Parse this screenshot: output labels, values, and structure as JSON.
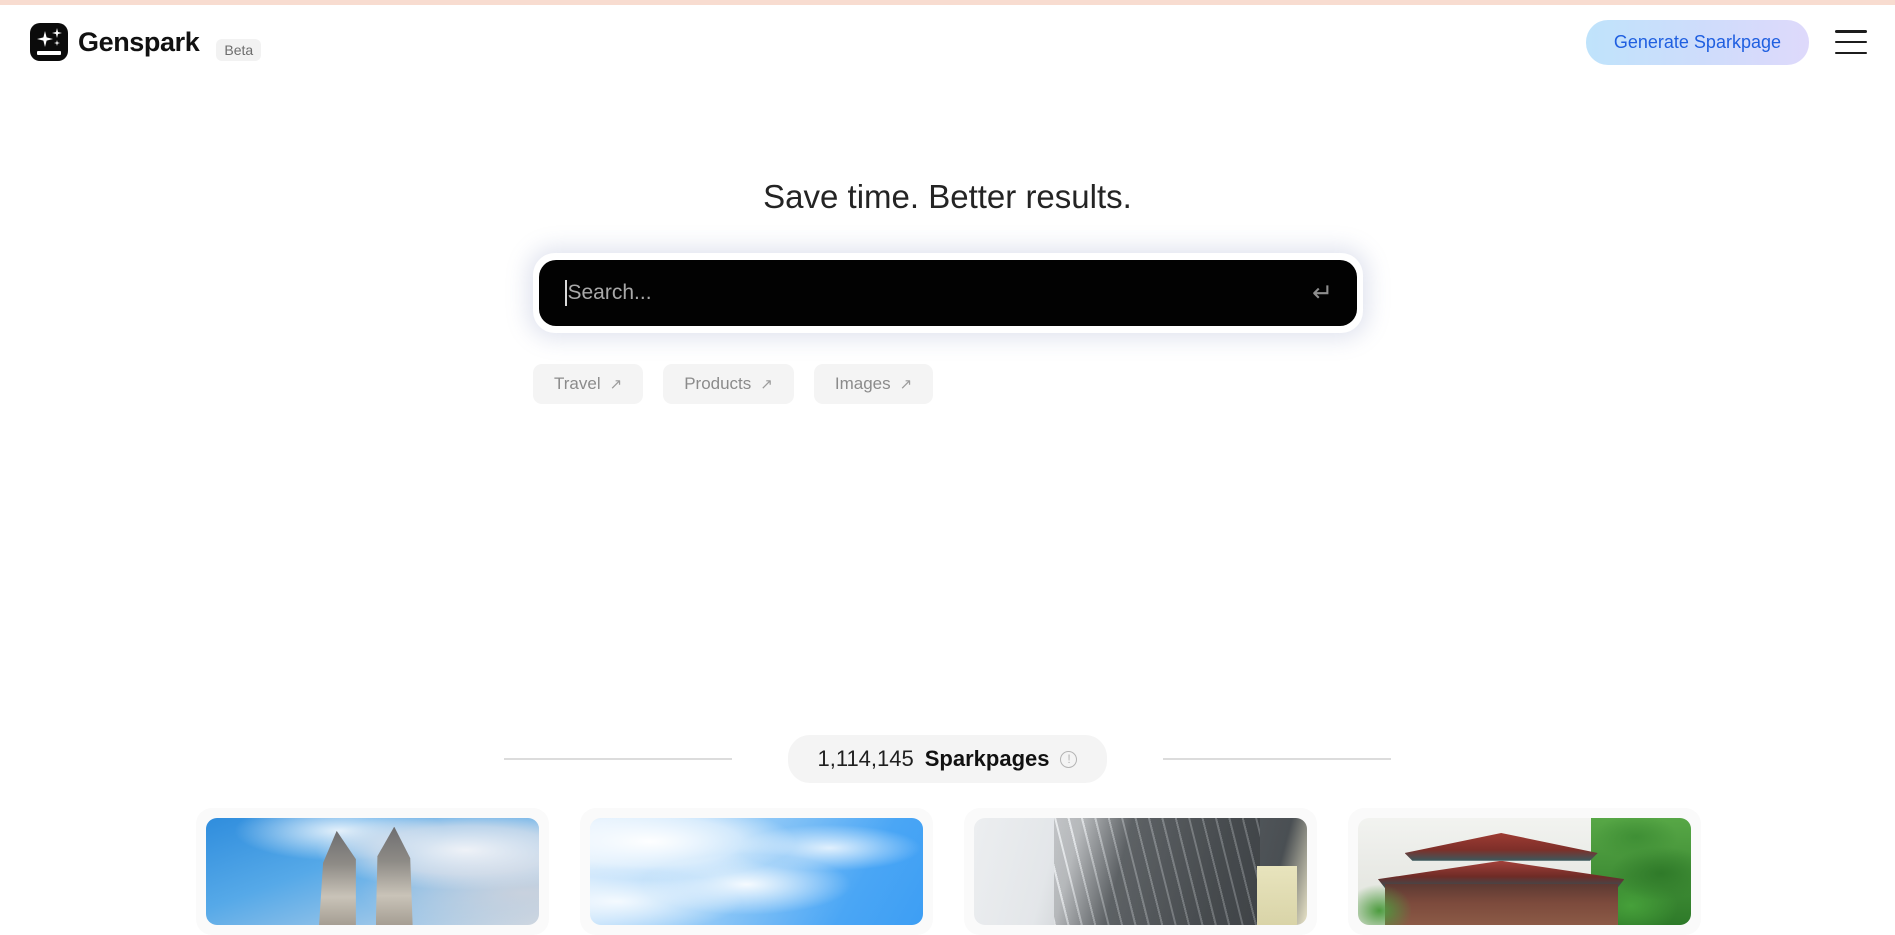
{
  "top_stripe_color": "#f8dcd0",
  "header": {
    "logo_icon": "gensark-sparkle-logo",
    "brand_name": "Genspark",
    "beta_badge": "Beta",
    "generate_button_label": "Generate Sparkpage",
    "generate_button_text_color": "#1f5fe0",
    "generate_button_gradient_start": "#bfe3fb",
    "generate_button_gradient_end": "#ded9fb",
    "menu_icon": "hamburger-menu-icon"
  },
  "hero": {
    "title": "Save time. Better results."
  },
  "search": {
    "value": "",
    "placeholder": "Search...",
    "background_color": "#020202",
    "placeholder_color": "#a8a8a8",
    "submit_icon": "enter-return-arrow-icon",
    "submit_glyph": "↵",
    "caret_visible": true
  },
  "chips": [
    {
      "label": "Travel",
      "icon": "arrow-up-right-icon",
      "glyph": "↗"
    },
    {
      "label": "Products",
      "icon": "arrow-up-right-icon",
      "glyph": "↗"
    },
    {
      "label": "Images",
      "icon": "arrow-up-right-icon",
      "glyph": "↗"
    }
  ],
  "counter": {
    "count": "1,114,145",
    "label": "Sparkpages",
    "info_icon": "info-exclamation-circle-icon",
    "info_glyph": "!"
  },
  "cards": [
    {
      "name": "bali-split-gate-thumbnail",
      "art": "thumb-bali"
    },
    {
      "name": "blue-sky-clouds-thumbnail",
      "art": "thumb-sky"
    },
    {
      "name": "glass-building-facade-thumbnail",
      "art": "thumb-building"
    },
    {
      "name": "chinese-temple-thumbnail",
      "art": "thumb-temple"
    }
  ]
}
